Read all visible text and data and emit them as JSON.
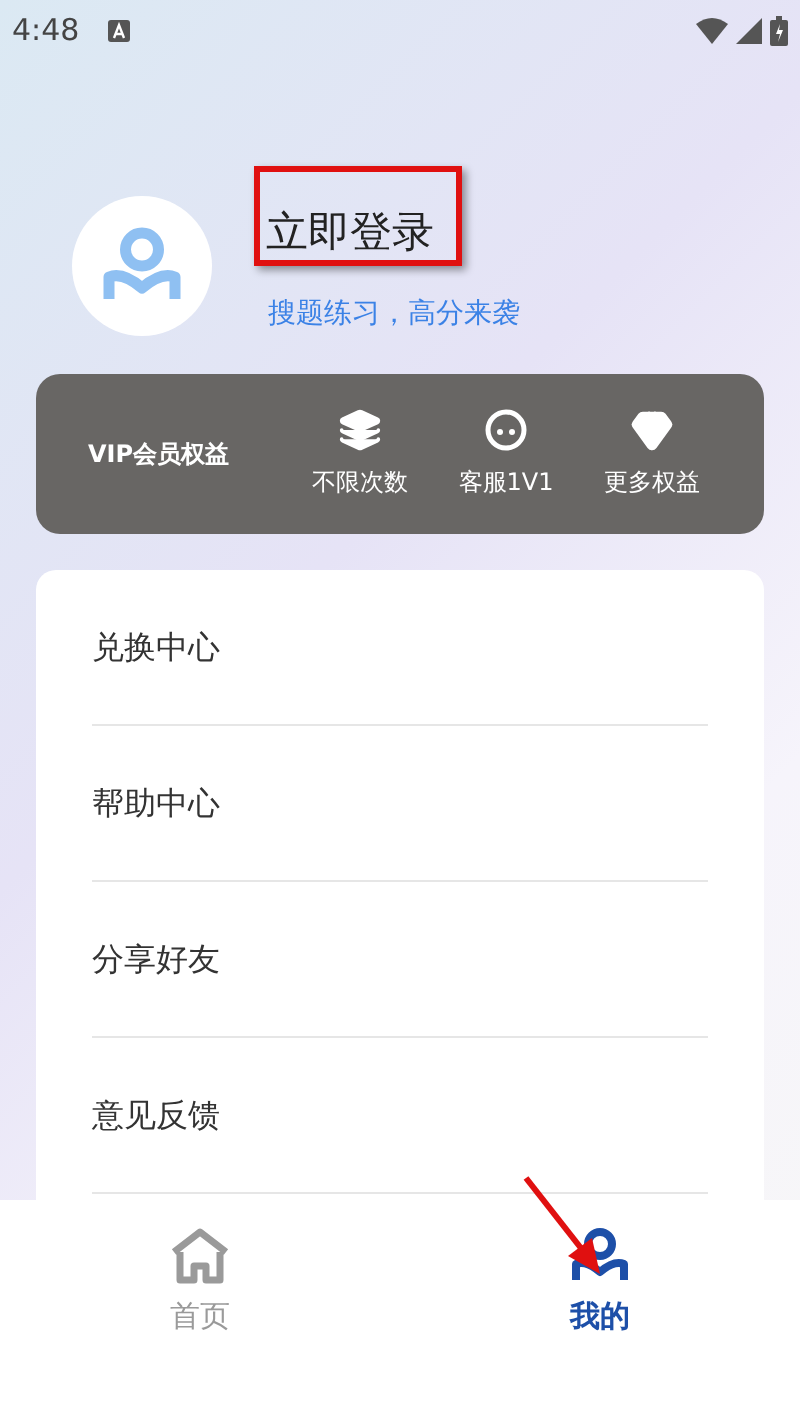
{
  "status_bar": {
    "time": "4:48"
  },
  "profile": {
    "title": "立即登录",
    "subtitle": "搜题练习，高分来袭"
  },
  "vip": {
    "label": "VIP会员权益",
    "items": [
      {
        "kind": "layers",
        "label": "不限次数"
      },
      {
        "kind": "service",
        "label": "客服1V1"
      },
      {
        "kind": "gem",
        "label": "更多权益"
      }
    ]
  },
  "menu": [
    "兑换中心",
    "帮助中心",
    "分享好友",
    "意见反馈"
  ],
  "tabs": [
    {
      "kind": "home",
      "label": "首页",
      "selected": false
    },
    {
      "kind": "me",
      "label": "我的",
      "selected": true
    }
  ]
}
